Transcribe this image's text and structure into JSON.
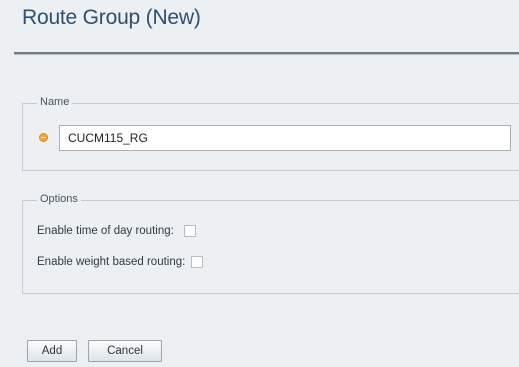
{
  "dialog": {
    "title": "Route Group (New)"
  },
  "name_section": {
    "legend": "Name",
    "input_value": "CUCM115_RG"
  },
  "options_section": {
    "legend": "Options",
    "time_of_day_label": "Enable time of day routing:",
    "time_of_day_checked": false,
    "weight_based_label": "Enable weight based routing:",
    "weight_based_checked": false
  },
  "buttons": {
    "add_label": "Add",
    "cancel_label": "Cancel"
  },
  "colors": {
    "title": "#2e4f6e",
    "background": "#ecf0f3",
    "required_indicator": "#f4a632"
  },
  "icons": {
    "required_indicator": "required-dot-icon"
  }
}
